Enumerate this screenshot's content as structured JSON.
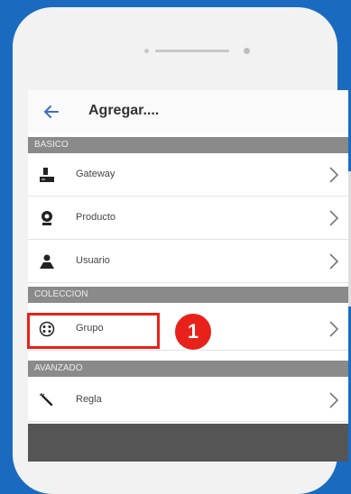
{
  "header": {
    "title": "Agregar...."
  },
  "sections": {
    "basico": "BASICO",
    "coleccion": "COLECCION",
    "avanzado": "AVANZADO"
  },
  "items": {
    "gateway": {
      "label": "Gateway",
      "icon": "gateway-icon"
    },
    "producto": {
      "label": "Producto",
      "icon": "webcam-icon"
    },
    "usuario": {
      "label": "Usuario",
      "icon": "user-icon"
    },
    "grupo": {
      "label": "Grupo",
      "icon": "group-icon"
    },
    "regla": {
      "label": "Regla",
      "icon": "wand-icon"
    }
  },
  "annotation": {
    "badge": "1",
    "color": "#e8211a"
  },
  "colors": {
    "background": "#1a6bbf",
    "section": "#8a8a8a"
  }
}
